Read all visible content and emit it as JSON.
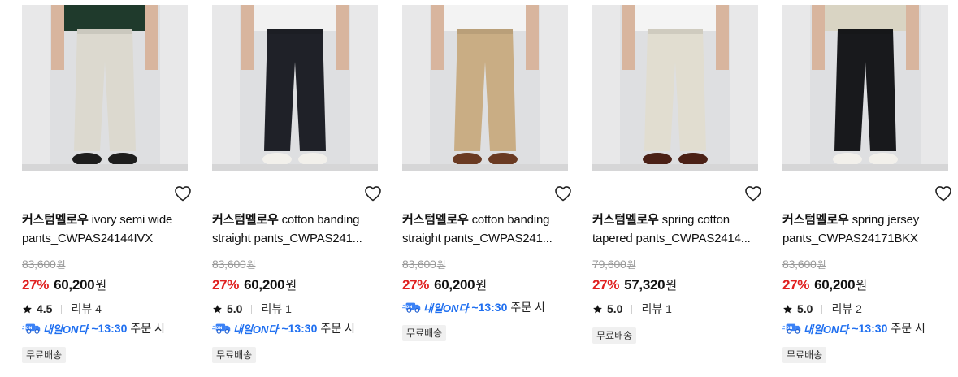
{
  "products": [
    {
      "brand": "커스텀멜로우",
      "name": "ivory semi wide pants_CWPAS24144IVX",
      "original_price": "83,600",
      "currency": "원",
      "discount": "27%",
      "price": "60,200",
      "rating": "4.5",
      "reviews": "리뷰 4",
      "delivery": {
        "label": "내일ON다",
        "time": "~13:30",
        "text": "주문 시"
      },
      "badge": "무료배송",
      "pants_color": "#dcd9cf",
      "shoe_color": "#1d1d1d"
    },
    {
      "brand": "커스텀멜로우",
      "name": "cotton banding straight pants_CWPAS241...",
      "original_price": "83,600",
      "currency": "원",
      "discount": "27%",
      "price": "60,200",
      "rating": "5.0",
      "reviews": "리뷰 1",
      "delivery": {
        "label": "내일ON다",
        "time": "~13:30",
        "text": "주문 시"
      },
      "badge": "무료배송",
      "pants_color": "#1f2128",
      "shoe_color": "#f2f0eb"
    },
    {
      "brand": "커스텀멜로우",
      "name": "cotton banding straight pants_CWPAS241...",
      "original_price": "83,600",
      "currency": "원",
      "discount": "27%",
      "price": "60,200",
      "rating": "",
      "reviews": "",
      "delivery": {
        "label": "내일ON다",
        "time": "~13:30",
        "text": "주문 시"
      },
      "badge": "무료배송",
      "pants_color": "#c9ad84",
      "shoe_color": "#6a3a22"
    },
    {
      "brand": "커스텀멜로우",
      "name": "spring cotton tapered pants_CWPAS2414...",
      "original_price": "79,600",
      "currency": "원",
      "discount": "27%",
      "price": "57,320",
      "rating": "5.0",
      "reviews": "리뷰 1",
      "delivery": null,
      "badge": "무료배송",
      "pants_color": "#e1ddd0",
      "shoe_color": "#4a2016"
    },
    {
      "brand": "커스텀멜로우",
      "name": "spring jersey pants_CWPAS24171BKX",
      "original_price": "83,600",
      "currency": "원",
      "discount": "27%",
      "price": "60,200",
      "rating": "5.0",
      "reviews": "리뷰 2",
      "delivery": {
        "label": "내일ON다",
        "time": "~13:30",
        "text": "주문 시"
      },
      "badge": "무료배송",
      "pants_color": "#18191c",
      "shoe_color": "#f2f0eb"
    }
  ],
  "icons": {
    "like": "heart-outline-icon",
    "star": "star-icon",
    "delivery": "delivery-truck-icon"
  },
  "colors": {
    "discount": "#e02020",
    "delivery_accent": "#1f6ff0",
    "badge_bg": "#f0f0f0"
  }
}
